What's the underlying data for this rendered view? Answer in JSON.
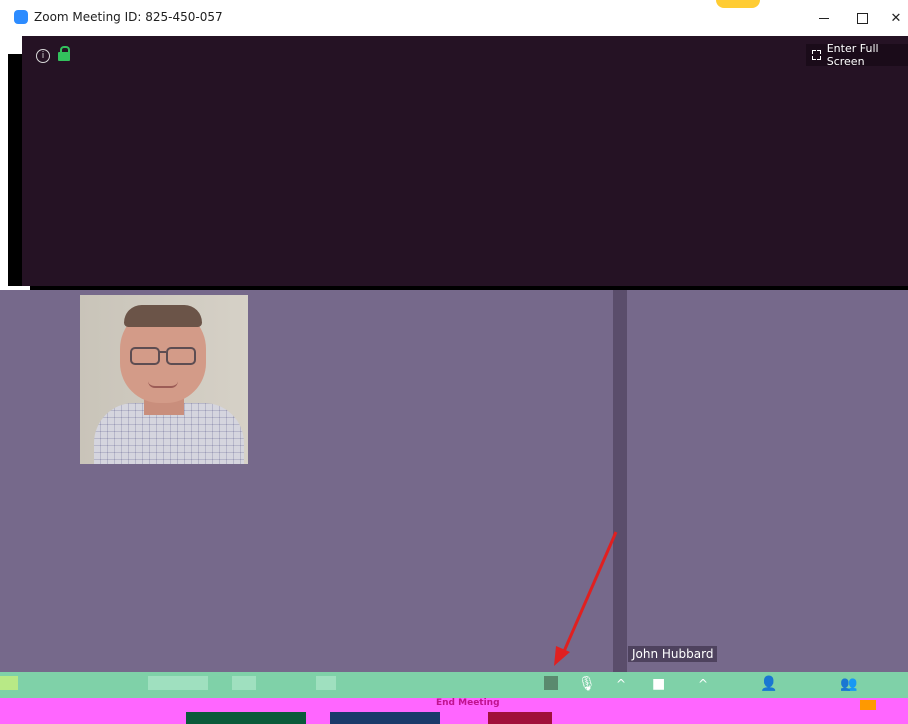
{
  "window": {
    "title": "Zoom Meeting ID: 825-450-057",
    "minimize_symbol": "—",
    "maximize_symbol": "□",
    "close_symbol": "✕"
  },
  "share": {
    "info_icon": "info-icon",
    "lock_icon": "lock-icon",
    "fullscreen_label": "Enter Full Screen"
  },
  "participants": {
    "name": "John Hubbard"
  },
  "toolbar": {
    "end_label": "End Meeting",
    "icons": [
      "mute-icon",
      "video-icon",
      "invite-icon",
      "participants-icon"
    ]
  },
  "colors": {
    "share_bg": "#251224",
    "video_bg": "#76698b",
    "arrow": "#e02020"
  }
}
